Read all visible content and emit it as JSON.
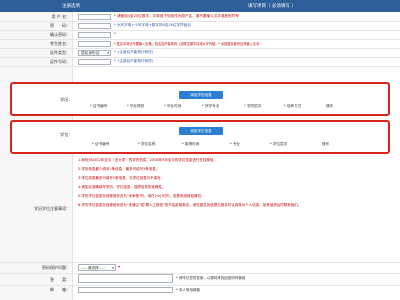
{
  "header": {
    "col1": "注册选项",
    "col2": "填写项目（ 必须填写 ）"
  },
  "form": {
    "username": {
      "label": "用 户 名：",
      "note": "* 请使用4至20位数字、字母或下划线作为用户名，请不要输入汉字或其他符号"
    },
    "password": {
      "label": "密　　码：",
      "note": "* 大写字母+小写字母+数字的6至16位字符组合"
    },
    "confirm": {
      "label": "确认密码：",
      "note": "*"
    },
    "candidate_name": {
      "label": "考生姓名：",
      "note": "* 姓名中间请不要输入空格，姓名如不能体改（如带生僻字请用★字代替，* 请按居民身份证号输入名字）"
    },
    "id_type": {
      "label": "证件类型：",
      "value": "居民身份证",
      "note": "*（注册后不能再行修改）"
    },
    "id_number": {
      "label": "证件号码：",
      "note": "*（注册后不能再行修改）"
    },
    "degree": {
      "label": "学位：",
      "add_button": "添加学位信息",
      "columns": [
        "* 证书编号",
        "* 学位名称",
        "* 取得时间",
        "* 专业",
        "* 学位层次",
        "操作"
      ]
    },
    "education": {
      "label": "学历：",
      "add_button": "添加学历信息",
      "columns": [
        "* 证书编号",
        "* 毕业院校",
        "* 毕业时间",
        "* 所学专业",
        "* 学历层次",
        "* 培养方式",
        "操作"
      ]
    },
    "education_notes": {
      "label": "学历学位注意事项：",
      "items": [
        "1.我校对2002年至今（含大学）的学历信息、2008年9月至今的学位信息进行在线核验。",
        "2.学历信息最少填写1条信息，最多可填写5条信息。",
        "3.学位信息最多可填写5条信息，无学位信息可不填写。",
        "4.请如实准确填写学历、学位信息，保障信息的准确性。",
        "5.学历学位信息在线核验状态为\"未审核\"时，请在24小时内，查看系统核验情况。",
        "6.学历学位信息在线核验状态为\"未通过\"或\"需人工核查\"的不会影响报名，请在报名系统提交报名时认真核对个人信息，如有误请及时联系我们。"
      ]
    },
    "security_question": {
      "label": "密码保护问题：",
      "value": "-----请选择-----"
    },
    "answer": {
      "label": "答　　案：",
      "note": "* 请牢记您的答案，以便将来找回密码时使用"
    },
    "email": {
      "label": "邮　　箱：",
      "note": "* 本人常用邮箱"
    }
  },
  "colors": {
    "header_bg": "#2f5f9a",
    "accent_red": "#d9231d",
    "button_blue": "#2b7fd2"
  }
}
